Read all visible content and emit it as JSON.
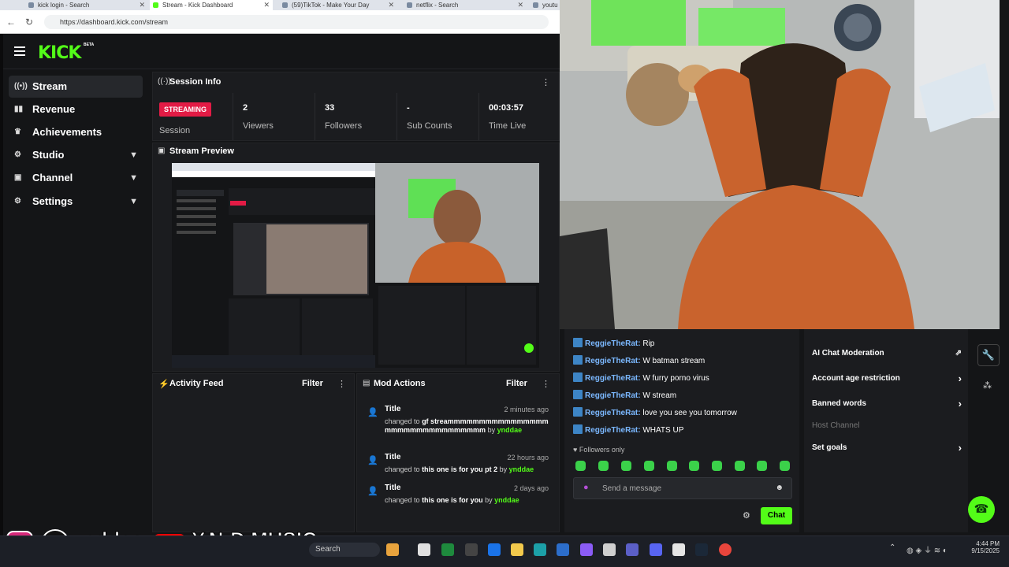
{
  "browser": {
    "tabs": [
      {
        "label": "kick login - Search",
        "active": false
      },
      {
        "label": "Stream - Kick Dashboard",
        "active": true
      },
      {
        "label": "(59)TikTok - Make Your Day",
        "active": false
      },
      {
        "label": "netflix - Search",
        "active": false
      },
      {
        "label": "youtu",
        "active": false
      }
    ],
    "url": "https://dashboard.kick.com/stream"
  },
  "app": {
    "logo": "KICK",
    "logo_beta": "BETA",
    "sidebar": [
      {
        "label": "Stream",
        "icon": "broadcast-icon",
        "active": true,
        "expandable": false
      },
      {
        "label": "Revenue",
        "icon": "chart-icon",
        "active": false,
        "expandable": false
      },
      {
        "label": "Achievements",
        "icon": "trophy-icon",
        "active": false,
        "expandable": false
      },
      {
        "label": "Studio",
        "icon": "gear-icon",
        "active": false,
        "expandable": true
      },
      {
        "label": "Channel",
        "icon": "channel-icon",
        "active": false,
        "expandable": true
      },
      {
        "label": "Settings",
        "icon": "gear-icon",
        "active": false,
        "expandable": true
      }
    ],
    "session": {
      "title": "Session Info",
      "status_badge": "STREAMING",
      "status_label": "Session",
      "stats": [
        {
          "value": "2",
          "label": "Viewers"
        },
        {
          "value": "33",
          "label": "Followers"
        },
        {
          "value": "-",
          "label": "Sub Counts"
        },
        {
          "value": "00:03:57",
          "label": "Time Live"
        }
      ]
    },
    "preview": {
      "title": "Stream Preview"
    },
    "activity_feed": {
      "title": "Activity Feed",
      "filter_label": "Filter"
    },
    "mod_actions": {
      "title": "Mod Actions",
      "filter_label": "Filter",
      "entries": [
        {
          "title": "Title",
          "time": "2 minutes ago",
          "prefix": "changed to",
          "value": "gf streammmmmmmmmmmmmmmmmmmmmmmmmmmmmmmm",
          "by": "by",
          "user": "ynddae"
        },
        {
          "title": "Title",
          "time": "22 hours ago",
          "prefix": "changed to",
          "value": "this one is for you pt 2",
          "by": "by",
          "user": "ynddae"
        },
        {
          "title": "Title",
          "time": "2 days ago",
          "prefix": "changed to",
          "value": "this one is for you",
          "by": "by",
          "user": "ynddae"
        }
      ]
    }
  },
  "chat": {
    "messages": [
      {
        "user": "ReggieTheRat:",
        "text": "Rip"
      },
      {
        "user": "ReggieTheRat:",
        "text": "W batman stream"
      },
      {
        "user": "ReggieTheRat:",
        "text": "W furry porno virus"
      },
      {
        "user": "ReggieTheRat:",
        "text": "W stream"
      },
      {
        "user": "ReggieTheRat:",
        "text": "love you see you tomorrow"
      },
      {
        "user": "ReggieTheRat:",
        "text": "WHATS UP"
      }
    ],
    "mode_label": "Followers only",
    "input_placeholder": "Send a message",
    "send_label": "Chat",
    "accent": "#53fc18"
  },
  "moderation": {
    "items": [
      {
        "label": "AI Chat Moderation",
        "enabled": true,
        "trailing": "external-link-icon"
      },
      {
        "label": "Account age restriction",
        "enabled": true,
        "trailing": "chevron-right-icon"
      },
      {
        "label": "Banned words",
        "enabled": true,
        "trailing": "chevron-right-icon"
      },
      {
        "label": "Host Channel",
        "enabled": false,
        "trailing": ""
      },
      {
        "label": "Set goals",
        "enabled": true,
        "trailing": "chevron-right-icon"
      }
    ]
  },
  "overlay": {
    "tiktok_handle": "ynddae",
    "youtube_handle": "Y.N:D MUSIC"
  },
  "taskbar": {
    "search_label": "Search",
    "time": "4:44 PM",
    "date": "9/15/2025"
  },
  "colors": {
    "kick_green": "#53fc18",
    "streaming_red": "#e31b45",
    "chat_user": "#7bb8ff"
  }
}
